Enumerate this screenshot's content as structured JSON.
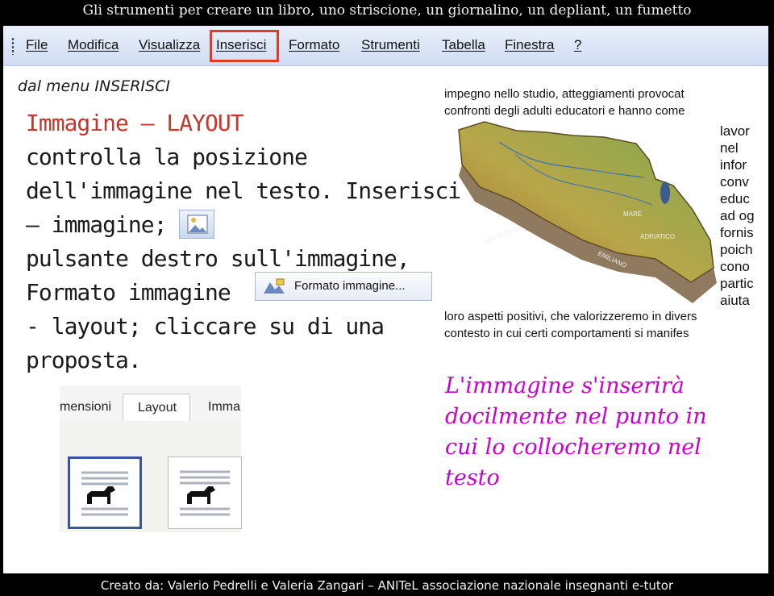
{
  "window": {
    "title": "Gli strumenti per creare un libro, uno striscione, un giornalino, un depliant, un fumetto"
  },
  "menubar": {
    "items": [
      "File",
      "Modifica",
      "Visualizza",
      "Inserisci",
      "Formato",
      "Strumenti",
      "Tabella",
      "Finestra",
      "?"
    ],
    "highlighted": "Inserisci"
  },
  "instructions": {
    "subtitle": "dal menu INSERISCI",
    "heading": "Immagine – LAYOUT",
    "lines": [
      "controlla          la          posizione",
      "dell'immagine nel testo. Inserisci",
      "– immagine;",
      "pulsante destro sull'immagine,",
      "Formato immagine",
      "-  layout;  cliccare  su  di  una",
      "proposta."
    ]
  },
  "context_menu": {
    "label": "Formato immagine..."
  },
  "layout_panel": {
    "tabs": [
      "mensioni",
      "Layout",
      "Imma"
    ],
    "active_tab": "Layout"
  },
  "document_preview": {
    "top_lines": [
      "impegno nello studio, atteggiamenti provocat",
      "confronti degli adulti educatori e hanno come"
    ],
    "side_words": [
      "lavor",
      "nel",
      "infor",
      "conv",
      "educ",
      "ad og",
      "fornis",
      "poich",
      "cono",
      "partic",
      "aiuta"
    ],
    "bottom_lines": [
      "loro aspetti positivi, che valorizzeremo in divers",
      "contesto in cui certi comportamenti  si manifes"
    ],
    "map_labels": [
      "MARE",
      "ADRIATICO",
      "APP. TOSCO",
      "EMILIANO"
    ]
  },
  "callout": {
    "text": "L'immagine s'inserirà docilmente nel punto in cui lo collocheremo nel testo"
  },
  "footer": {
    "credit": "Creato da: Valerio Pedrelli e Valeria Zangari – ANITeL associazione nazionale insegnanti e-tutor"
  }
}
